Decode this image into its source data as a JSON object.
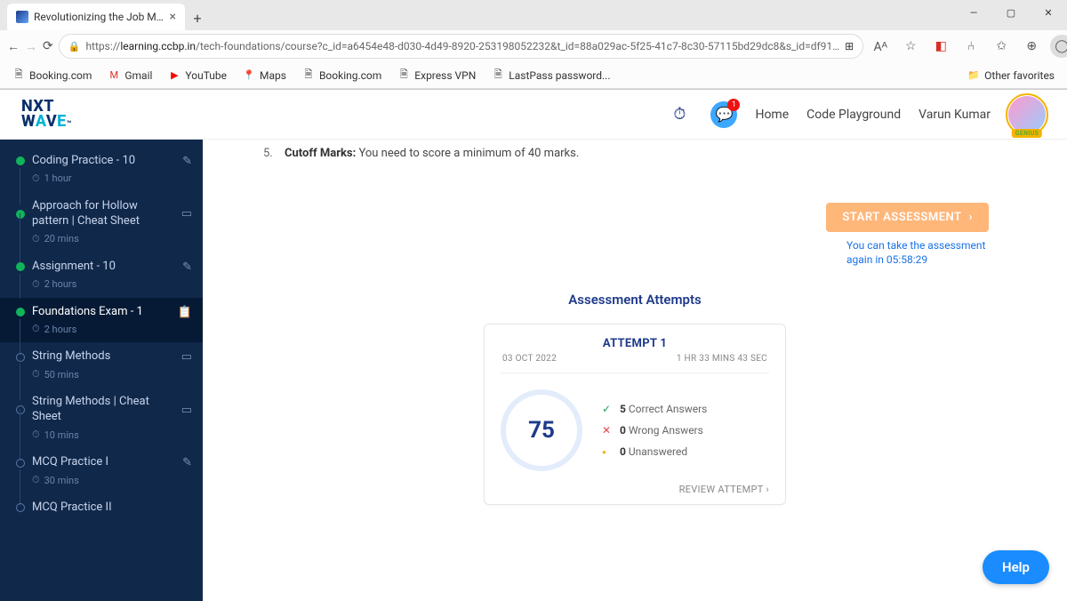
{
  "browser": {
    "tab_title": "Revolutionizing the Job Market |",
    "url_prefix": "https://",
    "url_host": "learning.ccbp.in",
    "url_path": "/tech-foundations/course?c_id=a6454e48-d030-4d49-8920-253198052232&t_id=88a029ac-5f25-41c7-8c30-57115bd29dc8&s_id=df91…",
    "bookmarks": [
      "Booking.com",
      "Gmail",
      "YouTube",
      "Maps",
      "Booking.com",
      "Express VPN",
      "LastPass password..."
    ],
    "other_favorites": "Other favorites"
  },
  "header": {
    "logo_line1": "NXT",
    "logo_line2a": "W",
    "logo_line2b": "A",
    "logo_line2c": "V",
    "logo_line2d": "E",
    "logo_line2_tm": "™",
    "chat_badge": "1",
    "links": {
      "home": "Home",
      "playground": "Code Playground"
    },
    "username": "Varun Kumar",
    "genius": "GENIUS"
  },
  "sidebar": [
    {
      "status": "done",
      "label": "Coding Practice - 10",
      "trail": "pencil",
      "time": "1 hour"
    },
    {
      "status": "done",
      "label": "Approach for Hollow pattern | Cheat Sheet",
      "trail": "book",
      "time": "20 mins"
    },
    {
      "status": "done",
      "label": "Assignment - 10",
      "trail": "pencil",
      "time": "2 hours"
    },
    {
      "status": "done",
      "label": "Foundations Exam - 1",
      "trail": "clipboard",
      "time": "2 hours",
      "active": true
    },
    {
      "status": "pending",
      "label": "String Methods",
      "trail": "book",
      "time": "50 mins"
    },
    {
      "status": "pending",
      "label": "String Methods | Cheat Sheet",
      "trail": "book",
      "time": "10 mins"
    },
    {
      "status": "pending",
      "label": "MCQ Practice I",
      "trail": "pencil",
      "time": "30 mins"
    },
    {
      "status": "pending",
      "label": "MCQ Practice II",
      "trail": "",
      "time": ""
    }
  ],
  "main": {
    "cutoff_num": "5.",
    "cutoff_label": "Cutoff Marks:",
    "cutoff_text": " You need to score a minimum of 40 marks.",
    "start_btn": "START ASSESSMENT",
    "start_note": "You can take the assessment again in 05:58:29",
    "attempts_heading": "Assessment Attempts",
    "attempt": {
      "title": "ATTEMPT 1",
      "date": "03 OCT 2022",
      "duration": "1 HR 33 MINS 43 SEC",
      "score": "75",
      "correct_n": "5",
      "correct_t": " Correct Answers",
      "wrong_n": "0",
      "wrong_t": " Wrong Answers",
      "unans_n": "0",
      "unans_t": " Unanswered",
      "review": "REVIEW ATTEMPT ›"
    },
    "help": "Help"
  }
}
